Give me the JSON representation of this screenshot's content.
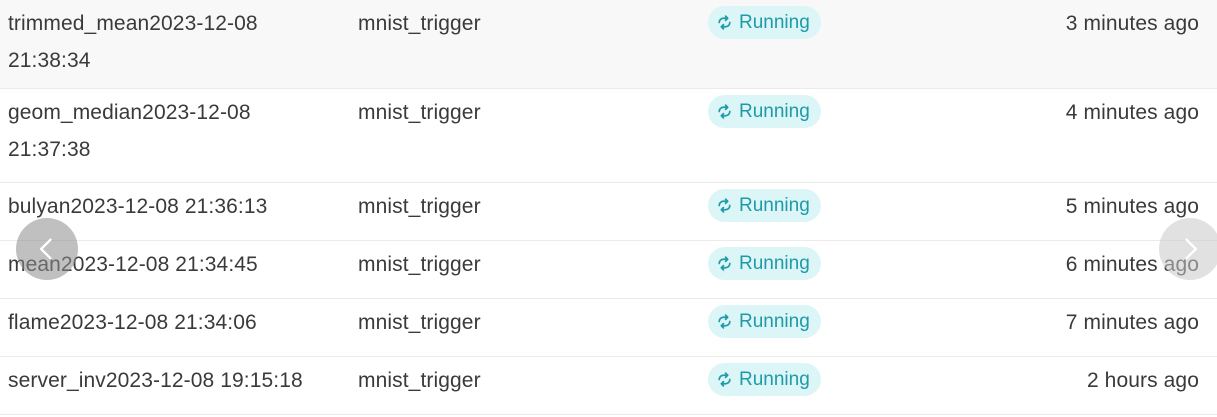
{
  "rows": [
    {
      "name": "trimmed_mean2023-12-08 21:38:34",
      "trigger": "mnist_trigger",
      "status": "Running",
      "time": "3 minutes ago"
    },
    {
      "name": "geom_median2023-12-08 21:37:38",
      "trigger": "mnist_trigger",
      "status": "Running",
      "time": "4 minutes ago"
    },
    {
      "name": "bulyan2023-12-08 21:36:13",
      "trigger": "mnist_trigger",
      "status": "Running",
      "time": "5 minutes ago"
    },
    {
      "name": "mean2023-12-08 21:34:45",
      "trigger": "mnist_trigger",
      "status": "Running",
      "time": "6 minutes ago"
    },
    {
      "name": "flame2023-12-08 21:34:06",
      "trigger": "mnist_trigger",
      "status": "Running",
      "time": "7 minutes ago"
    },
    {
      "name": "server_inv2023-12-08 19:15:18",
      "trigger": "mnist_trigger",
      "status": "Running",
      "time": "2 hours ago"
    }
  ],
  "icons": {
    "status": "sync-icon",
    "prev": "chevron-left-icon",
    "next": "chevron-right-icon"
  },
  "colors": {
    "badge_bg": "#dcf5f7",
    "badge_text": "#1e9aa8",
    "text": "#3a3a3a"
  }
}
